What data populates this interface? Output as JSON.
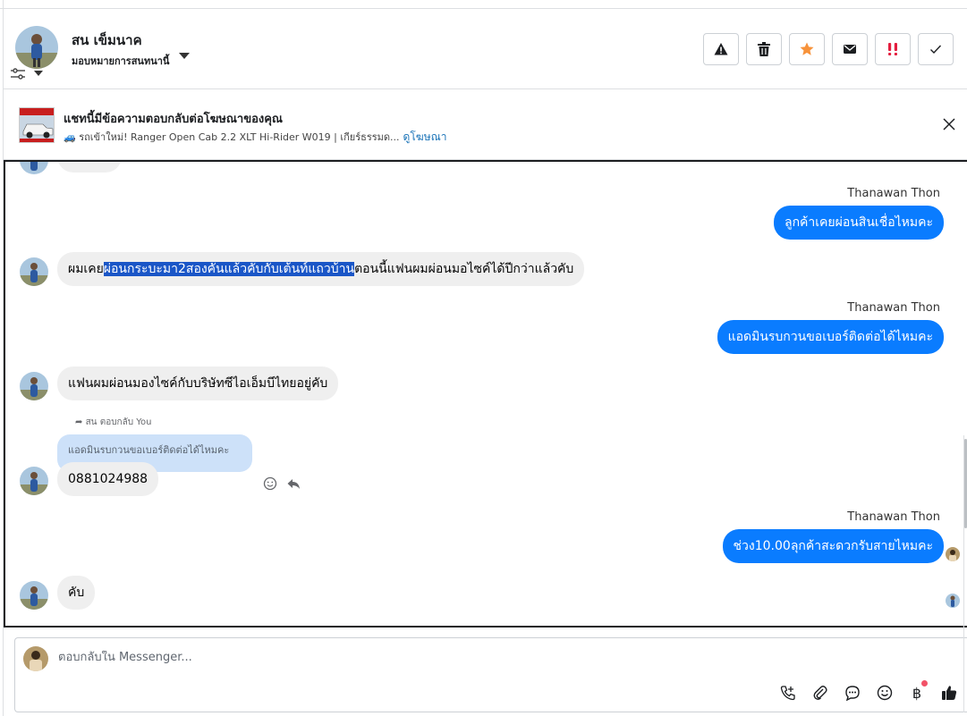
{
  "header": {
    "contact_name": "สน เข็มนาค",
    "assign_label": "มอบหมายการสนทนานี้",
    "actions": [
      {
        "name": "report-button",
        "icon": "warning-icon"
      },
      {
        "name": "delete-button",
        "icon": "trash-icon"
      },
      {
        "name": "star-button",
        "icon": "star-icon"
      },
      {
        "name": "mark-unread-button",
        "icon": "envelope-icon"
      },
      {
        "name": "spam-button",
        "icon": "double-exclamation-icon"
      },
      {
        "name": "done-button",
        "icon": "checkmark-icon"
      }
    ],
    "star_color": "#f7923a",
    "spam_color": "#e41e3f"
  },
  "ad": {
    "title": "แชทนี้มีข้อความตอบกลับต่อโฆษณาของคุณ",
    "line": "🚙 รถเข้าใหม่! Ranger Open Cab 2.2 XLT Hi-Rider W019 | เกียร์ธรรมด...",
    "link": "ดูโฆษณา"
  },
  "chat": {
    "accent": "#0a7cff",
    "messages": {
      "out1_sender": "Thanawan Thon",
      "out1_text": "ลูกค้าเคยผ่อนสินเชื่อไหมคะ",
      "in1_pre": "ผมเคย",
      "in1_hl": "ผ่อนกระบะมา2สองคันแล้วคับกับเต้นท์แถวบ้าน",
      "in1_post": "ตอนนี้แฟนผมผ่อนมอไซค์ได้ปีกว่าแล้วคับ",
      "out2_sender": "Thanawan Thon",
      "out2_text": "แอดมินรบกวนขอเบอร์ติดต่อได้ไหมคะ",
      "in2_text": "แฟนผมผ่อนมองไซค์กับบริษัทซีไอเอ็มบีไทยอยู่คับ",
      "reply_note": "สน ตอบกลับ You",
      "quoted_text": "แอดมินรบกวนขอเบอร์ติดต่อได้ไหมคะ",
      "in3_text": "0881024988",
      "out3_sender": "Thanawan Thon",
      "out3_text": "ช่วง10.00ลุกค้าสะดวกรับสายไหมคะ",
      "in4_text": "คับ"
    }
  },
  "composer": {
    "placeholder": "ตอบกลับใน Messenger...",
    "tools": [
      "phone-add-icon",
      "paperclip-icon",
      "chat-bubble-icon",
      "emoji-icon",
      "baht-icon",
      "thumbs-up-icon"
    ]
  }
}
